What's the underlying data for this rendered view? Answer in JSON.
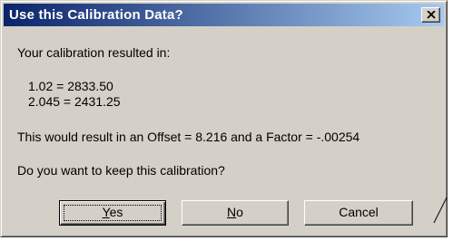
{
  "window": {
    "title": "Use this Calibration Data?"
  },
  "body": {
    "intro": "Your calibration resulted in:",
    "lines": [
      "1.02 = 2833.50",
      "2.045 = 2431.25"
    ],
    "result": "This would result in an Offset = 8.216 and a Factor = -.00254",
    "question": "Do you want to keep this calibration?"
  },
  "buttons": {
    "yes": {
      "mnemonic": "Y",
      "rest": "es"
    },
    "no": {
      "mnemonic": "N",
      "rest": "o"
    },
    "cancel": "Cancel"
  },
  "icons": {
    "close": "close-icon"
  }
}
